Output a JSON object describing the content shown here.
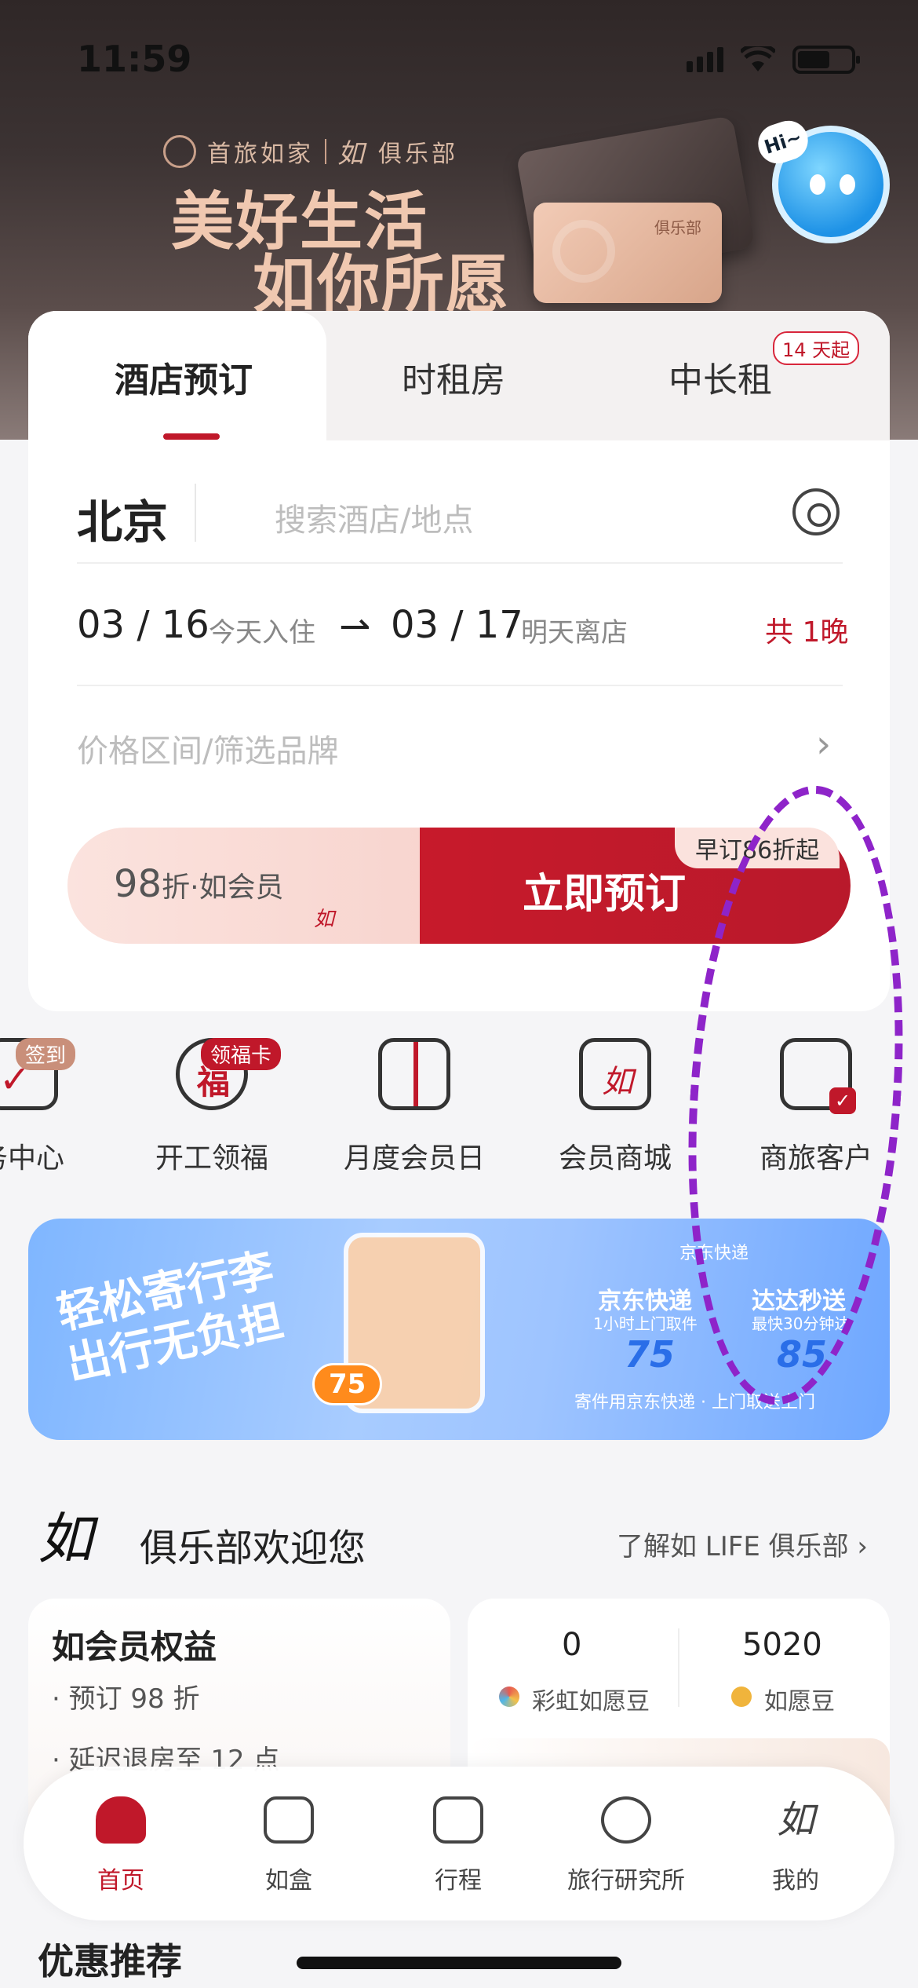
{
  "status_bar": {
    "time": "11:59"
  },
  "hero": {
    "brand_name": "首旅如家",
    "club_name": "俱乐部",
    "slogan_line1": "美好生活",
    "slogan_line2": "如你所愿",
    "card_mark": "俱乐部",
    "mascot_greeting": "Hi~"
  },
  "booking_tabs": [
    {
      "label": "酒店预订",
      "active": true
    },
    {
      "label": "时租房",
      "active": false
    },
    {
      "label": "中长租",
      "active": false,
      "badge": "14 天起"
    }
  ],
  "search": {
    "city": "北京",
    "placeholder": "搜索酒店/地点"
  },
  "dates": {
    "checkin": "03 / 16",
    "checkin_note": "今天入住",
    "checkout": "03 / 17",
    "checkout_note": "明天离店",
    "nights": "共 1晚"
  },
  "filter": {
    "placeholder": "价格区间/筛选品牌"
  },
  "book_button": {
    "member_discount": "98",
    "member_discount_unit": "折",
    "member_label": "·如会员",
    "label": "立即预订",
    "early_tag": "早订86折起"
  },
  "quick_entries": [
    {
      "label": "务中心",
      "tag": "签到",
      "icon": "task-check-icon"
    },
    {
      "label": "开工领福",
      "tag": "领福卡",
      "icon": "fortune-bag-icon"
    },
    {
      "label": "月度会员日",
      "icon": "gift-icon"
    },
    {
      "label": "会员商城",
      "icon": "shop-bag-icon"
    },
    {
      "label": "商旅客户",
      "icon": "briefcase-icon"
    }
  ],
  "jd_banner": {
    "title1": "轻松寄行李",
    "title2": "出行无负担",
    "promo_pill": "75",
    "brand": "京东快递",
    "box1_head": "京东快递",
    "box1_sub": "1小时上门取件",
    "box1_price": "75",
    "box2_head": "达达秒送",
    "box2_sub": "最快30分钟达",
    "box2_price": "85",
    "footer": "寄件用京东快递 · 上门取送上门"
  },
  "club": {
    "title": "俱乐部欢迎您",
    "link": "了解如 LIFE 俱乐部 ›",
    "benefits_title": "如会员权益",
    "benefits": [
      "· 预订 98 折",
      "· 延迟退房至 12 点"
    ],
    "points": [
      {
        "value": "0",
        "label": "彩虹如愿豆",
        "color": "#f2a14a"
      },
      {
        "value": "5020",
        "label": "如愿豆",
        "color": "#f0b43c"
      }
    ]
  },
  "tabbar": [
    {
      "label": "首页",
      "icon": "home-icon",
      "active": true
    },
    {
      "label": "如盒",
      "icon": "box-icon",
      "active": false
    },
    {
      "label": "行程",
      "icon": "suitcase-icon",
      "active": false
    },
    {
      "label": "旅行研究所",
      "icon": "planet-icon",
      "active": false
    },
    {
      "label": "我的",
      "icon": "profile-logo-icon",
      "active": false
    }
  ],
  "section": {
    "title": "优惠推荐"
  },
  "colors": {
    "brand_red": "#c0182a",
    "annotation": "#8e24c9"
  }
}
